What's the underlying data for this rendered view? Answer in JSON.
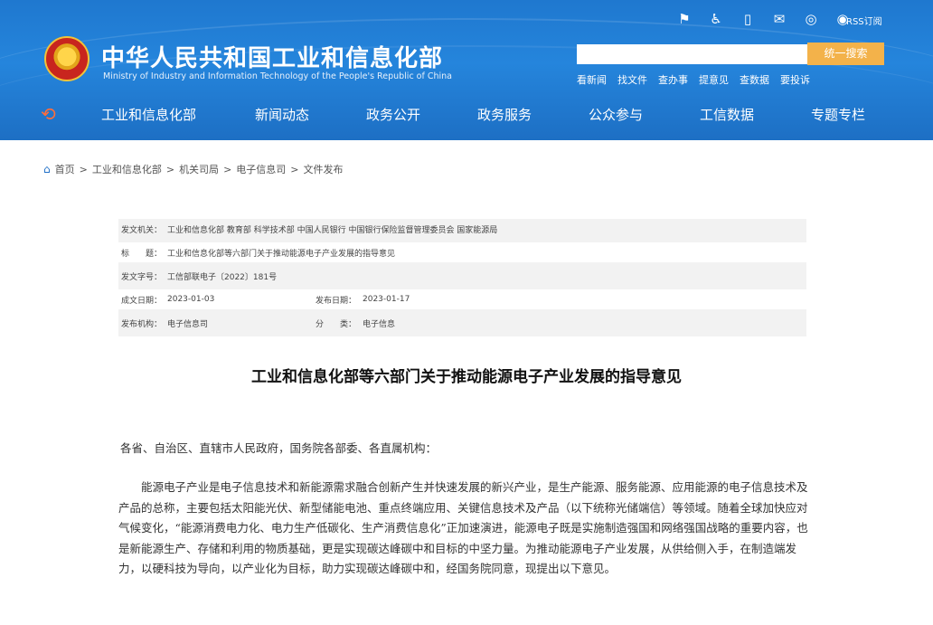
{
  "header": {
    "title_cn": "中华人民共和国工业和信息化部",
    "title_en": "Ministry of Industry and Information Technology of the People's Republic of China",
    "util_icons": [
      "mobile-icon",
      "accessibility-icon",
      "phone-icon",
      "mail-icon",
      "wechat-icon",
      "weibo-icon"
    ],
    "rss_label": "RSS订阅",
    "search": {
      "value": "",
      "button": "统一搜索"
    },
    "quick_links": [
      "看新闻",
      "找文件",
      "查办事",
      "提意见",
      "查数据",
      "要投诉"
    ],
    "nav": [
      "工业和信息化部",
      "新闻动态",
      "政务公开",
      "政务服务",
      "公众参与",
      "工信数据",
      "专题专栏"
    ]
  },
  "breadcrumb": [
    "首页",
    "工业和信息化部",
    "机关司局",
    "电子信息司",
    "文件发布"
  ],
  "breadcrumb_sep": ">",
  "meta": {
    "issuer_label": "发文机关：",
    "issuer": "工业和信息化部 教育部 科学技术部 中国人民银行 中国银行保险监督管理委员会 国家能源局",
    "title_label": "标　　题：",
    "title": "工业和信息化部等六部门关于推动能源电子产业发展的指导意见",
    "docno_label": "发文字号：",
    "docno": "工信部联电子〔2022〕181号",
    "written_label": "成文日期：",
    "written": "2023-01-03",
    "published_label": "发布日期：",
    "published": "2023-01-17",
    "org_label": "发布机构：",
    "org": "电子信息司",
    "category_label": "分　　类：",
    "category": "电子信息"
  },
  "article": {
    "title": "工业和信息化部等六部门关于推动能源电子产业发展的指导意见",
    "salutation": "各省、自治区、直辖市人民政府，国务院各部委、各直属机构：",
    "paragraph": "能源电子产业是电子信息技术和新能源需求融合创新产生并快速发展的新兴产业，是生产能源、服务能源、应用能源的电子信息技术及产品的总称，主要包括太阳能光伏、新型储能电池、重点终端应用、关键信息技术及产品（以下统称光储端信）等领域。随着全球加快应对气候变化，“能源消费电力化、电力生产低碳化、生产消费信息化”正加速演进，能源电子既是实施制造强国和网络强国战略的重要内容，也是新能源生产、存储和利用的物质基础，更是实现碳达峰碳中和目标的中坚力量。为推动能源电子产业发展，从供给侧入手，在制造端发力，以硬科技为导向，以产业化为目标，助力实现碳达峰碳中和，经国务院同意，现提出以下意见。"
  }
}
